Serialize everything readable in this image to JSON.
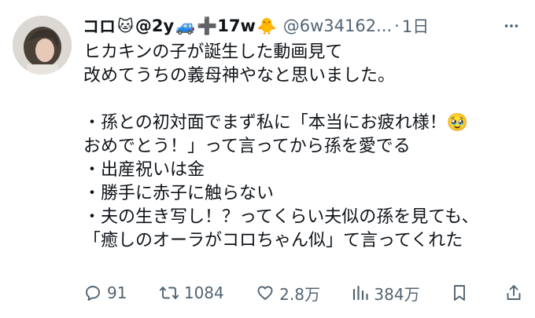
{
  "tweet": {
    "author": {
      "name": "コロ",
      "name_emoji": "🐱",
      "name_part2": "@2y",
      "name_emoji2": "🚙",
      "name_part3": "➕17w",
      "name_emoji3": "🐥",
      "handle": "@6w34162...",
      "separator": "·",
      "time": "1日"
    },
    "lines": [
      "ヒカキンの子が誕生した動画見て",
      "改めてうちの義母神やなと思いました。",
      "",
      "・孫との初対面でまず私に「本当にお疲れ様！🥹",
      "おめでとう！」って言ってから孫を愛でる",
      "・出産祝いは金",
      "・勝手に赤子に触らない",
      "・夫の生き写し！？ってくらい夫似の孫を見ても、",
      "「癒しのオーラがコロちゃん似」て言ってくれた"
    ],
    "stats": {
      "replies": "91",
      "retweets": "1084",
      "likes": "2.8万",
      "views": "384万"
    }
  },
  "icons": {
    "more": "more-horizontal-icon",
    "reply": "reply-icon",
    "retweet": "retweet-icon",
    "like": "heart-icon",
    "views": "analytics-icon",
    "bookmark": "bookmark-icon",
    "share": "share-icon"
  },
  "colors": {
    "text": "#0f1419",
    "secondary": "#536471"
  }
}
